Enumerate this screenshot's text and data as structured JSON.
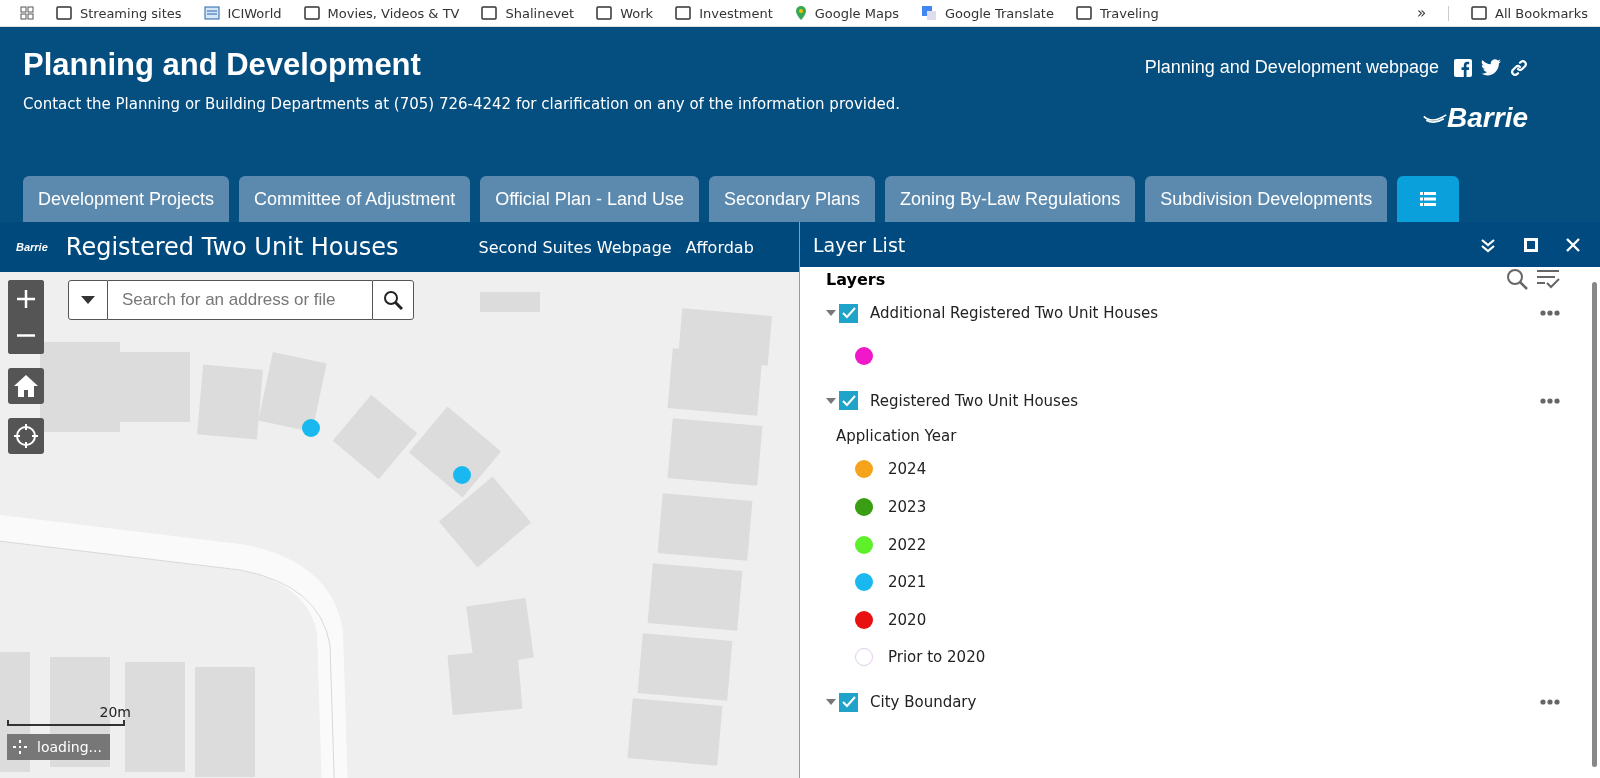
{
  "bookmarks": [
    {
      "kind": "folder",
      "label": "Streaming sites"
    },
    {
      "kind": "page",
      "label": "ICIWorld"
    },
    {
      "kind": "folder",
      "label": "Movies, Videos & TV"
    },
    {
      "kind": "folder",
      "label": "Shalinevet"
    },
    {
      "kind": "folder",
      "label": "Work"
    },
    {
      "kind": "folder",
      "label": "Investment"
    },
    {
      "kind": "maps",
      "label": "Google Maps"
    },
    {
      "kind": "translate",
      "label": "Google Translate"
    },
    {
      "kind": "folder",
      "label": "Traveling"
    }
  ],
  "bookmarks_overflow": "»",
  "all_bookmarks": "All Bookmarks",
  "header": {
    "title": "Planning and Development",
    "subtitle": "Contact the Planning or Building Departments at (705) 726-4242 for clarification on any of the information provided.",
    "link": "Planning and Development webpage",
    "logo": "Barrie"
  },
  "tabs": [
    {
      "kind": "text",
      "label": "Development Projects",
      "selected": false
    },
    {
      "kind": "text",
      "label": "Committee of Adjustment",
      "selected": false
    },
    {
      "kind": "text",
      "label": "Official Plan - Land Use",
      "selected": false
    },
    {
      "kind": "text",
      "label": "Secondary Plans",
      "selected": false
    },
    {
      "kind": "text",
      "label": "Zoning By-Law Regulations",
      "selected": false
    },
    {
      "kind": "text",
      "label": "Subdivision Developments",
      "selected": false
    },
    {
      "kind": "icon",
      "selected": true
    }
  ],
  "app_bar": {
    "logo": "Barrie",
    "title": "Registered Two Unit Houses",
    "links": [
      "Second Suites Webpage",
      "Affordab"
    ]
  },
  "map": {
    "search_placeholder": "Search for an address or file",
    "scale": "20m",
    "status": "loading...",
    "markers": [
      {
        "color": "#1ab8f0"
      },
      {
        "color": "#1ab8f0"
      }
    ]
  },
  "layer_panel": {
    "title": "Layer List",
    "heading": "Layers",
    "layers": [
      {
        "name": "Additional Registered Two Unit Houses",
        "checked": true,
        "expanded": true,
        "legend": [
          {
            "kind": "filled",
            "color": "#f018c8"
          }
        ]
      },
      {
        "name": "Registered Two Unit Houses",
        "checked": true,
        "expanded": true,
        "legend_title": "Application Year",
        "legend": [
          {
            "kind": "filled",
            "color": "#f5a31a",
            "label": "2024"
          },
          {
            "kind": "filled",
            "color": "#3a9e14",
            "label": "2023"
          },
          {
            "kind": "filled",
            "color": "#5ef02a",
            "label": "2022"
          },
          {
            "kind": "filled",
            "color": "#1ab8f0",
            "label": "2021"
          },
          {
            "kind": "filled",
            "color": "#e81010",
            "label": "2020"
          },
          {
            "kind": "outline",
            "color": "#e2cdea",
            "label": "Prior to 2020"
          }
        ]
      },
      {
        "name": "City Boundary",
        "checked": true,
        "expanded": true
      }
    ]
  }
}
